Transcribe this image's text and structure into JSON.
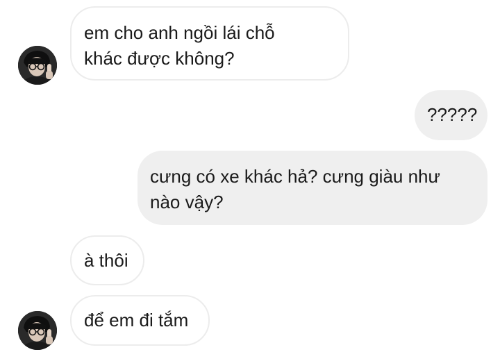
{
  "conversation": {
    "messages": [
      {
        "direction": "incoming",
        "lines": [
          "em cho anh ngồi lái chỗ",
          "khác được không?"
        ]
      },
      {
        "direction": "outgoing",
        "lines": [
          "?????"
        ]
      },
      {
        "direction": "outgoing",
        "lines": [
          "cưng có xe khác hả? cưng giàu như",
          "nào vậy?"
        ]
      },
      {
        "direction": "incoming",
        "lines": [
          "à thôi"
        ]
      },
      {
        "direction": "incoming",
        "lines": [
          "để em đi tắm"
        ]
      }
    ]
  },
  "colors": {
    "incoming_bubble": "#ffffff",
    "incoming_border": "#ececec",
    "outgoing_bubble": "#efefef",
    "text": "#1a1a1a",
    "background": "#ffffff"
  },
  "icons": {
    "avatar": "profile-photo-avatar-icon"
  }
}
